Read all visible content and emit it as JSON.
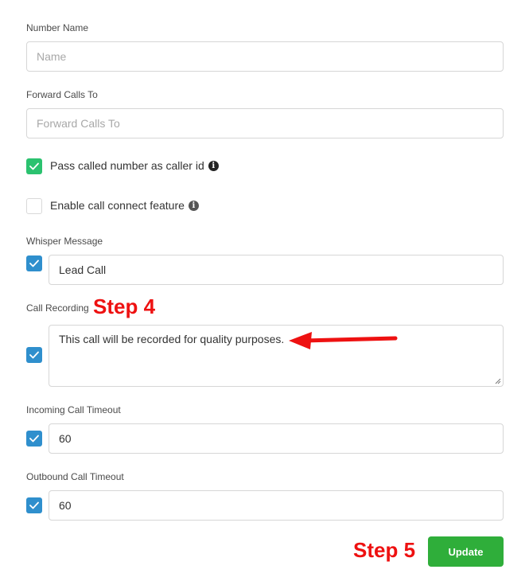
{
  "fields": {
    "number_name": {
      "label": "Number Name",
      "placeholder": "Name"
    },
    "forward_calls": {
      "label": "Forward Calls To",
      "placeholder": "Forward Calls To"
    },
    "pass_called_number": {
      "label": "Pass called number as caller id",
      "checked": true
    },
    "call_connect": {
      "label": "Enable call connect feature",
      "checked": false
    },
    "whisper": {
      "label": "Whisper Message",
      "value": "Lead Call",
      "checked": true
    },
    "call_recording": {
      "label": "Call Recording",
      "value": "This call will be recorded for quality purposes.",
      "checked": true
    },
    "incoming_timeout": {
      "label": "Incoming Call Timeout",
      "value": "60",
      "checked": true
    },
    "outbound_timeout": {
      "label": "Outbound Call Timeout",
      "value": "60",
      "checked": true
    }
  },
  "annotations": {
    "step4": "Step 4",
    "step5": "Step 5"
  },
  "buttons": {
    "update": "Update"
  },
  "colors": {
    "checkbox_green": "#2bc26f",
    "checkbox_blue": "#2f8fcd",
    "update_button": "#2fae3a",
    "annotation_red": "#ee1111"
  }
}
